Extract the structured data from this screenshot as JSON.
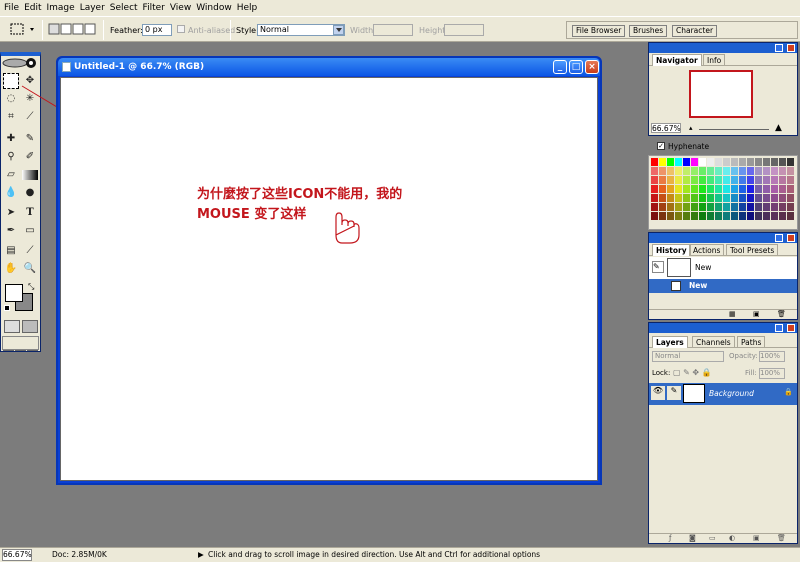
{
  "menu": [
    "File",
    "Edit",
    "Image",
    "Layer",
    "Select",
    "Filter",
    "View",
    "Window",
    "Help"
  ],
  "options": {
    "feather_label": "Feather:",
    "feather_value": "0 px",
    "antialiased_label": "Anti-aliased",
    "style_label": "Style:",
    "style_value": "Normal",
    "width_label": "Width:",
    "height_label": "Height:"
  },
  "palette_well_tabs": [
    "File Browser",
    "Brushes",
    "Character"
  ],
  "document": {
    "title": "Untitled-1 @ 66.7% (RGB)"
  },
  "annotation": {
    "line1": "为什麼按了这些ICON不能用，我的",
    "line2": "MOUSE 变了这样"
  },
  "navigator": {
    "tabs": [
      "Navigator",
      "Info"
    ],
    "zoom": "66.67%"
  },
  "hyphenate_label": "Hyphenate",
  "history": {
    "tabs": [
      "History",
      "Actions",
      "Tool Presets"
    ],
    "snapshot_label": "New",
    "state_label": "New"
  },
  "layers": {
    "tabs": [
      "Layers",
      "Channels",
      "Paths"
    ],
    "blend_mode": "Normal",
    "opacity_label": "Opacity:",
    "opacity_value": "100%",
    "lock_label": "Lock:",
    "fill_label": "Fill:",
    "fill_value": "100%",
    "layer_name": "Background"
  },
  "status": {
    "zoom": "66.67%",
    "doc": "Doc: 2.85M/0K",
    "hint": "Click and drag to scroll image in desired direction.  Use Alt and Ctrl for additional options"
  },
  "colors": {
    "accent": "#1c5fd0",
    "annotation": "#c3161c",
    "selection": "#316ac5"
  }
}
